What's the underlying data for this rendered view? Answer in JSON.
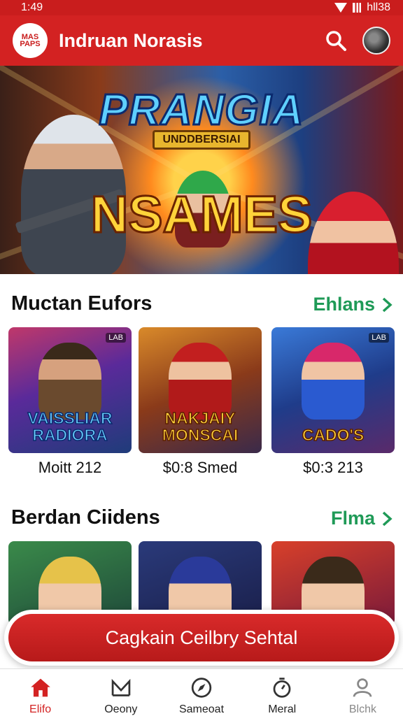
{
  "status": {
    "time": "1:49",
    "right": "hll38"
  },
  "app_bar": {
    "logo_text": "MAS PAPS",
    "title": "Indruan Norasis",
    "search_icon": "search-icon",
    "avatar_icon": "avatar-icon"
  },
  "hero": {
    "title": "PRANGIA",
    "badge": "UNDDBERSIAI",
    "subtitle": "NSAMES"
  },
  "section1": {
    "title": "Muctan Eufors",
    "link": "Ehlans",
    "cards": [
      {
        "name": "VAISSLIAR RADIORA",
        "price": "Moitt 212",
        "tag": "LAB"
      },
      {
        "name": "NAKJAIY MONSCAI",
        "price": "$0:8 Smed",
        "tag": ""
      },
      {
        "name": "CADO'S",
        "price": "$0:3 213",
        "tag": "LAB"
      }
    ]
  },
  "section2": {
    "title": "Berdan Ciidens",
    "link": "Flma"
  },
  "cta": {
    "label": "Cagkain Ceilbry Sehtal"
  },
  "nav": [
    {
      "label": "Elifo",
      "icon": "home-icon"
    },
    {
      "label": "Oeony",
      "icon": "category-icon"
    },
    {
      "label": "Sameoat",
      "icon": "compass-icon"
    },
    {
      "label": "Meral",
      "icon": "timer-icon"
    },
    {
      "label": "Blchk",
      "icon": "profile-icon"
    }
  ],
  "colors": {
    "primary": "#d32222",
    "link": "#1f9a57",
    "title": "#111111"
  }
}
